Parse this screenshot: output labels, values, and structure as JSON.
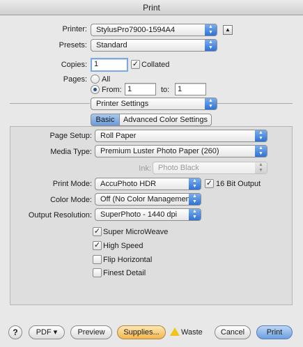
{
  "window": {
    "title": "Print"
  },
  "printer": {
    "label": "Printer:",
    "value": "StylusPro7900-1594A4",
    "expand_icon": "disclosure-triangle-up"
  },
  "presets": {
    "label": "Presets:",
    "value": "Standard"
  },
  "copies": {
    "label": "Copies:",
    "value": "1",
    "collated_label": "Collated",
    "collated_checked": true
  },
  "pages": {
    "label": "Pages:",
    "all_label": "All",
    "from_label": "From:",
    "from_value": "1",
    "to_label": "to:",
    "to_value": "1",
    "selected": "From"
  },
  "section": {
    "value": "Printer Settings"
  },
  "tabs": [
    {
      "label": "Basic",
      "selected": true
    },
    {
      "label": "Advanced Color Settings",
      "selected": false
    }
  ],
  "basic": {
    "page_setup": {
      "label": "Page Setup:",
      "value": "Roll Paper"
    },
    "media_type": {
      "label": "Media Type:",
      "value": "Premium Luster Photo Paper (260)"
    },
    "ink": {
      "label": "Ink:",
      "value": "Photo Black",
      "enabled": false
    },
    "print_mode": {
      "label": "Print Mode:",
      "value": "AccuPhoto HDR"
    },
    "sixteen_bit": {
      "label": "16 Bit Output",
      "checked": true
    },
    "color_mode": {
      "label": "Color Mode:",
      "value": "Off (No Color Management)"
    },
    "output_resolution": {
      "label": "Output Resolution:",
      "value": "SuperPhoto - 1440 dpi"
    },
    "options": [
      {
        "label": "Super MicroWeave",
        "checked": true
      },
      {
        "label": "High Speed",
        "checked": true
      },
      {
        "label": "Flip Horizontal",
        "checked": false
      },
      {
        "label": "Finest Detail",
        "checked": false
      }
    ]
  },
  "footer": {
    "help_label": "?",
    "pdf_label": "PDF ▾",
    "preview_label": "Preview",
    "supplies_label": "Supplies...",
    "waste_label": "Waste",
    "cancel_label": "Cancel",
    "print_label": "Print"
  },
  "colors": {
    "accent": "#2a6fd6",
    "default_button": "#6c9fe0",
    "supplies_button": "#f2b64f",
    "warning": "#f0c419"
  },
  "glyphs": {
    "checkmark": "✓",
    "arrow_up": "▲",
    "arrow_down": "▼"
  }
}
